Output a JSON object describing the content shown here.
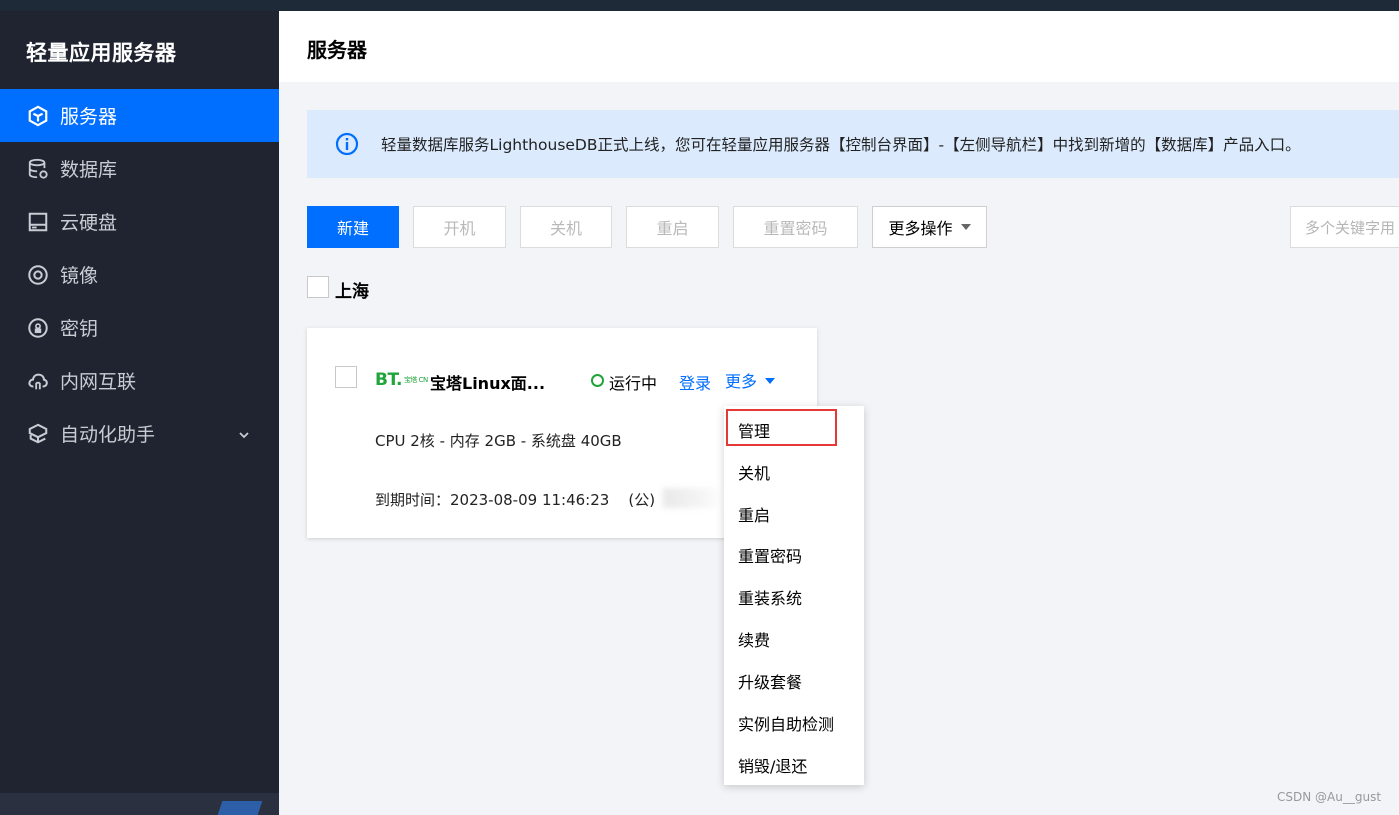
{
  "app": {
    "brand": "轻量应用服务器"
  },
  "sidebar": {
    "items": [
      {
        "label": "服务器",
        "icon": "cube-icon",
        "active": true
      },
      {
        "label": "数据库",
        "icon": "database-icon",
        "active": false
      },
      {
        "label": "云硬盘",
        "icon": "disk-icon",
        "active": false
      },
      {
        "label": "镜像",
        "icon": "image-target-icon",
        "active": false
      },
      {
        "label": "密钥",
        "icon": "key-lock-icon",
        "active": false
      },
      {
        "label": "内网互联",
        "icon": "cloud-link-icon",
        "active": false
      },
      {
        "label": "自动化助手",
        "icon": "automation-icon",
        "active": false,
        "expandable": true
      }
    ]
  },
  "header": {
    "title": "服务器"
  },
  "notice": {
    "icon": "info-icon",
    "text": "轻量数据库服务LighthouseDB正式上线，您可在轻量应用服务器【控制台界面】-【左侧导航栏】中找到新增的【数据库】产品入口。"
  },
  "toolbar": {
    "create": "新建",
    "start": "开机",
    "stop": "关机",
    "restart": "重启",
    "reset_password": "重置密码",
    "more_actions": "更多操作",
    "search_placeholder": "多个关键字用"
  },
  "region": {
    "label": "上海"
  },
  "instance": {
    "logo": "BT.",
    "logo_sub": "宝塔 CN",
    "name": "宝塔Linux面...",
    "status": "运行中",
    "login": "登录",
    "more": "更多",
    "spec": "CPU 2核 - 内存 2GB - 系统盘 40GB",
    "expire": "到期时间：2023-08-09 11:46:23",
    "ip_prefix": "(公)"
  },
  "dropdown": {
    "items": [
      "管理",
      "关机",
      "重启",
      "重置密码",
      "重装系统",
      "续费",
      "升级套餐",
      "实例自助检测",
      "销毁/退还"
    ],
    "highlighted": "管理"
  },
  "colors": {
    "accent": "#006eff",
    "sidebar_bg": "#1f2430",
    "status_green": "#1fa33a",
    "highlight_red": "#e53935",
    "bt_green": "#20a53a"
  },
  "watermark": "CSDN @Au__gust"
}
